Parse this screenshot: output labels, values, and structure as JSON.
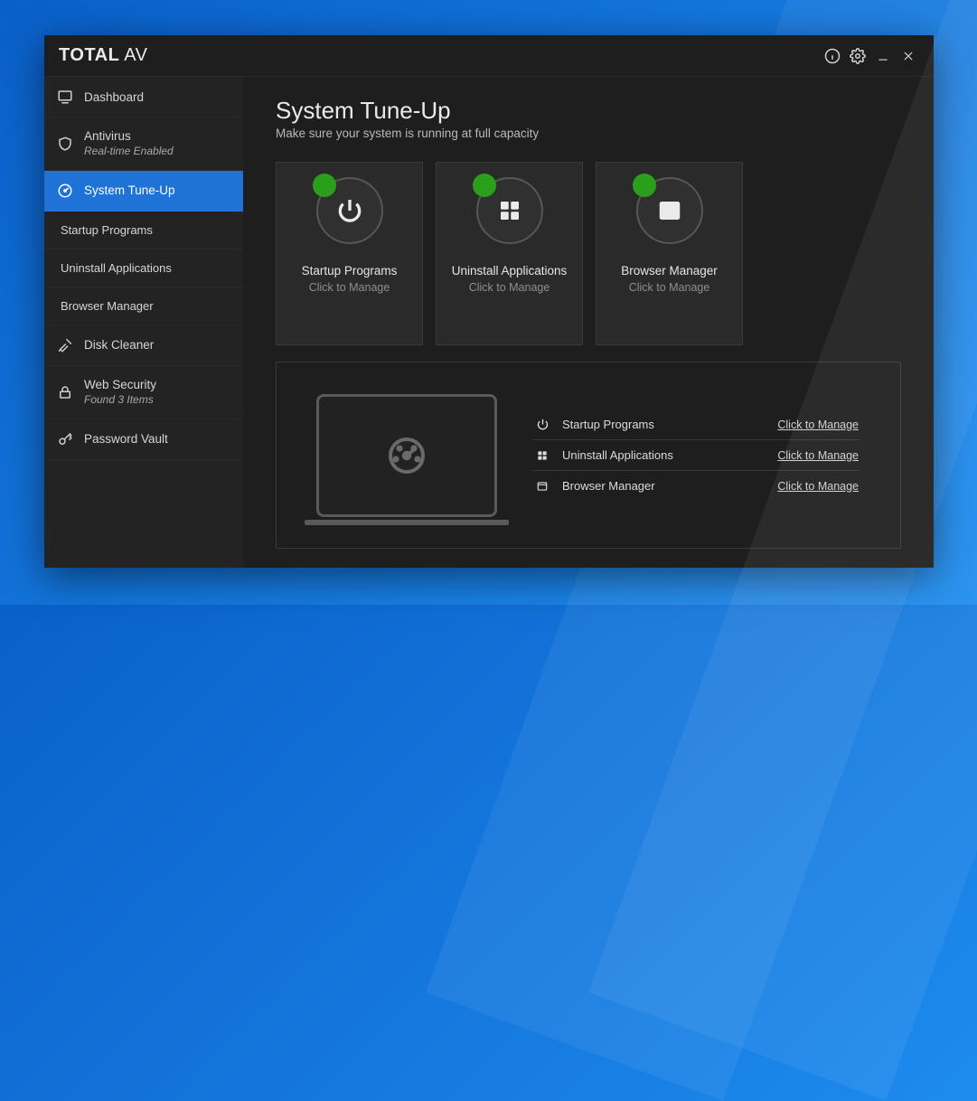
{
  "brand": {
    "bold": "TOTAL",
    "light": "AV"
  },
  "sidebar": [
    {
      "id": "dashboard",
      "label": "Dashboard"
    },
    {
      "id": "antivirus",
      "label": "Antivirus",
      "sub": "Real-time Enabled"
    },
    {
      "id": "tuneup",
      "label": "System Tune-Up"
    },
    {
      "id": "startup",
      "label": "Startup Programs"
    },
    {
      "id": "uninstall",
      "label": "Uninstall Applications"
    },
    {
      "id": "browser",
      "label": "Browser Manager"
    },
    {
      "id": "disk",
      "label": "Disk Cleaner"
    },
    {
      "id": "websec",
      "label": "Web Security",
      "sub": "Found 3 Items"
    },
    {
      "id": "vault",
      "label": "Password Vault"
    }
  ],
  "page": {
    "title": "System Tune-Up",
    "subtitle": "Make sure your system is running at full capacity"
  },
  "cards": [
    {
      "title": "Startup Programs",
      "action": "Click to Manage"
    },
    {
      "title": "Uninstall Applications",
      "action": "Click to Manage"
    },
    {
      "title": "Browser Manager",
      "action": "Click to Manage"
    }
  ],
  "rows": [
    {
      "label": "Startup Programs",
      "action": "Click to Manage"
    },
    {
      "label": "Uninstall Applications",
      "action": "Click to Manage"
    },
    {
      "label": "Browser Manager",
      "action": "Click to Manage"
    }
  ],
  "colors": {
    "accent": "#1f72d6",
    "status_ok": "#2aa01a"
  }
}
